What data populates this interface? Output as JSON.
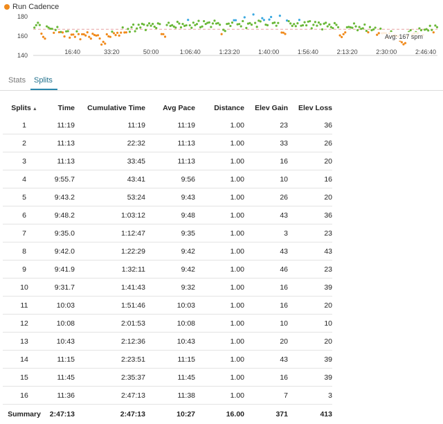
{
  "chart_data": {
    "type": "scatter",
    "legend": "Run Cadence",
    "y_ticks": [
      180,
      160,
      140
    ],
    "ylim": [
      140,
      180
    ],
    "x_ticks": [
      "16:40",
      "33:20",
      "50:00",
      "1:06:40",
      "1:23:20",
      "1:40:00",
      "1:56:40",
      "2:13:20",
      "2:30:00",
      "2:46:40"
    ],
    "x_tick_seconds": [
      1000,
      2000,
      3000,
      4000,
      5000,
      6000,
      7000,
      8000,
      9000,
      10000
    ],
    "xlim_seconds": [
      0,
      10300
    ],
    "average_line": 167,
    "average_label": "Avg: 167 spm",
    "colors": {
      "low": "#f08a1c",
      "mid": "#6ab838",
      "high": "#3aa8e0",
      "avg_line": "#e8a2a2"
    },
    "color_thresholds": {
      "low_below": 164,
      "high_above": 176
    },
    "series": [
      {
        "x": [
          100,
          350,
          600,
          850,
          1100,
          1350,
          1600,
          1850,
          2100,
          2400,
          2700,
          3000,
          3300,
          3600,
          3900,
          4200,
          4500,
          4800,
          5100,
          5400,
          5700,
          6000,
          6300,
          6600,
          6900,
          7200,
          7500,
          7800,
          8100,
          8400,
          8700,
          9000,
          9300,
          9600,
          9900,
          10200
        ],
        "y": [
          172,
          168,
          166,
          162,
          161,
          161,
          160,
          161,
          162,
          166,
          170,
          171,
          171,
          171,
          172,
          172,
          173,
          173,
          173,
          172,
          174,
          174,
          173,
          172,
          173,
          172,
          171,
          170,
          170,
          168,
          166,
          162,
          161,
          163,
          165,
          168
        ]
      }
    ]
  },
  "tabs": [
    {
      "label": "Stats",
      "active": false
    },
    {
      "label": "Splits",
      "active": true
    }
  ],
  "table": {
    "headers": {
      "split": "Splits",
      "time": "Time",
      "cumulative": "Cumulative Time",
      "pace": "Avg Pace",
      "distance": "Distance",
      "gain": "Elev Gain",
      "loss": "Elev Loss"
    },
    "rows": [
      [
        "1",
        "11:19",
        "11:19",
        "11:19",
        "1.00",
        "23",
        "36"
      ],
      [
        "2",
        "11:13",
        "22:32",
        "11:13",
        "1.00",
        "33",
        "26"
      ],
      [
        "3",
        "11:13",
        "33:45",
        "11:13",
        "1.00",
        "16",
        "20"
      ],
      [
        "4",
        "9:55.7",
        "43:41",
        "9:56",
        "1.00",
        "10",
        "16"
      ],
      [
        "5",
        "9:43.2",
        "53:24",
        "9:43",
        "1.00",
        "26",
        "20"
      ],
      [
        "6",
        "9:48.2",
        "1:03:12",
        "9:48",
        "1.00",
        "43",
        "36"
      ],
      [
        "7",
        "9:35.0",
        "1:12:47",
        "9:35",
        "1.00",
        "3",
        "23"
      ],
      [
        "8",
        "9:42.0",
        "1:22:29",
        "9:42",
        "1.00",
        "43",
        "43"
      ],
      [
        "9",
        "9:41.9",
        "1:32:11",
        "9:42",
        "1.00",
        "46",
        "23"
      ],
      [
        "10",
        "9:31.7",
        "1:41:43",
        "9:32",
        "1.00",
        "16",
        "39"
      ],
      [
        "11",
        "10:03",
        "1:51:46",
        "10:03",
        "1.00",
        "16",
        "20"
      ],
      [
        "12",
        "10:08",
        "2:01:53",
        "10:08",
        "1.00",
        "10",
        "10"
      ],
      [
        "13",
        "10:43",
        "2:12:36",
        "10:43",
        "1.00",
        "20",
        "20"
      ],
      [
        "14",
        "11:15",
        "2:23:51",
        "11:15",
        "1.00",
        "43",
        "39"
      ],
      [
        "15",
        "11:45",
        "2:35:37",
        "11:45",
        "1.00",
        "16",
        "39"
      ],
      [
        "16",
        "11:36",
        "2:47:13",
        "11:38",
        "1.00",
        "7",
        "3"
      ]
    ],
    "summary": [
      "Summary",
      "2:47:13",
      "2:47:13",
      "10:27",
      "16.00",
      "371",
      "413"
    ]
  }
}
